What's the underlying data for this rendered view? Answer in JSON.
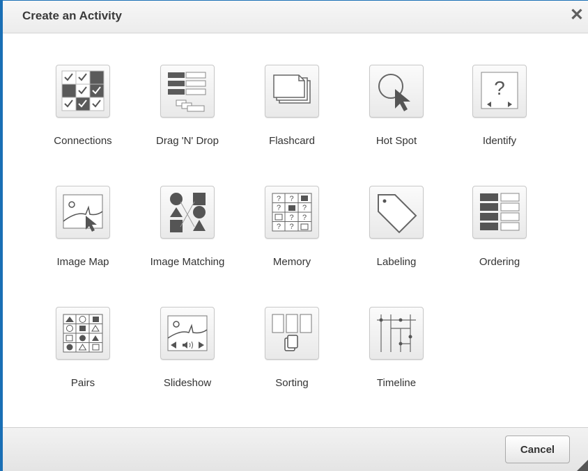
{
  "dialog": {
    "title": "Create an Activity",
    "close_glyph": "✕",
    "cancel_label": "Cancel"
  },
  "activities": [
    {
      "label": "Connections",
      "icon": "connections-icon"
    },
    {
      "label": "Drag 'N' Drop",
      "icon": "drag-n-drop-icon"
    },
    {
      "label": "Flashcard",
      "icon": "flashcard-icon"
    },
    {
      "label": "Hot Spot",
      "icon": "hot-spot-icon"
    },
    {
      "label": "Identify",
      "icon": "identify-icon"
    },
    {
      "label": "Image Map",
      "icon": "image-map-icon"
    },
    {
      "label": "Image Matching",
      "icon": "image-matching-icon"
    },
    {
      "label": "Memory",
      "icon": "memory-icon"
    },
    {
      "label": "Labeling",
      "icon": "labeling-icon"
    },
    {
      "label": "Ordering",
      "icon": "ordering-icon"
    },
    {
      "label": "Pairs",
      "icon": "pairs-icon"
    },
    {
      "label": "Slideshow",
      "icon": "slideshow-icon"
    },
    {
      "label": "Sorting",
      "icon": "sorting-icon"
    },
    {
      "label": "Timeline",
      "icon": "timeline-icon"
    }
  ],
  "colors": {
    "accent": "#1a6fb5",
    "icon_dark": "#5a5a5a"
  }
}
